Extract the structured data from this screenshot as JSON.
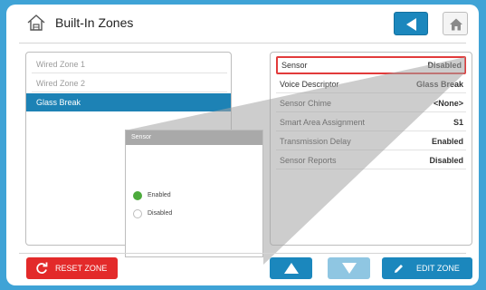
{
  "header": {
    "title": "Built-In Zones",
    "icon": "house-outline-icon"
  },
  "zones": [
    {
      "label": "Wired Zone 1",
      "selected": false
    },
    {
      "label": "Wired Zone 2",
      "selected": false
    },
    {
      "label": "Glass Break",
      "selected": true
    }
  ],
  "details": [
    {
      "key": "Sensor",
      "value": "Disabled",
      "highlighted": true
    },
    {
      "key": "Voice Descriptor",
      "value": "Glass Break"
    },
    {
      "key": "Sensor Chime",
      "value": "<None>"
    },
    {
      "key": "Smart Area Assignment",
      "value": "S1"
    },
    {
      "key": "Transmission Delay",
      "value": "Enabled"
    },
    {
      "key": "Sensor Reports",
      "value": "Disabled"
    }
  ],
  "popup": {
    "title": "Sensor",
    "options": [
      {
        "label": "Enabled",
        "selected": true
      },
      {
        "label": "Disabled",
        "selected": false
      }
    ]
  },
  "buttons": {
    "reset": "RESET ZONE",
    "edit": "EDIT ZONE"
  },
  "colors": {
    "background": "#3fa3d6",
    "accent": "#1b87bd",
    "danger": "#e32a2a",
    "highlight_border": "#e23b3b",
    "radio_on": "#4caa3c"
  }
}
